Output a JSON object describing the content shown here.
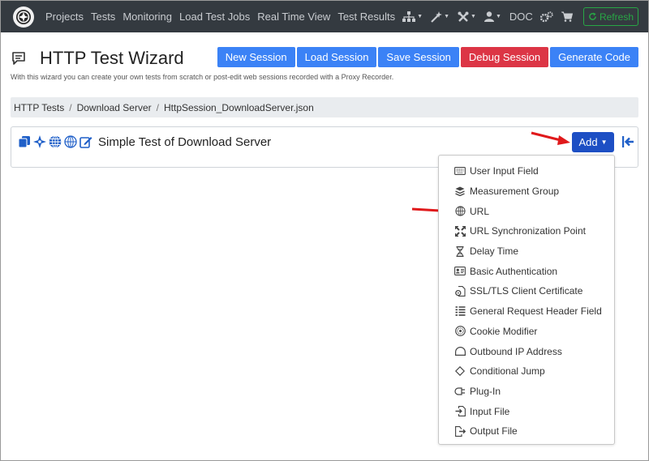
{
  "nav": {
    "links": [
      "Projects",
      "Tests",
      "Monitoring",
      "Load Test Jobs",
      "Real Time View",
      "Test Results"
    ],
    "doc": "DOC",
    "refresh": "Refresh",
    "icons": [
      "sitemap-icon",
      "wand-icon",
      "tools-icon",
      "user-icon",
      "gears-icon",
      "cart-icon"
    ]
  },
  "header": {
    "title": "HTTP Test Wizard",
    "subtitle": "With this wizard you can create your own tests from scratch or post-edit web sessions recorded with a Proxy Recorder.",
    "buttons": {
      "new_session": "New Session",
      "load_session": "Load Session",
      "save_session": "Save Session",
      "debug_session": "Debug Session",
      "generate_code": "Generate Code"
    }
  },
  "breadcrumb": [
    "HTTP Tests",
    "Download Server",
    "HttpSession_DownloadServer.json"
  ],
  "test": {
    "title": "Simple Test of Download Server",
    "add_label": "Add"
  },
  "dropdown": {
    "items": [
      {
        "label": "User Input Field",
        "icon": "keyboard-icon"
      },
      {
        "label": "Measurement Group",
        "icon": "layers-icon"
      },
      {
        "label": "URL",
        "icon": "globe-icon"
      },
      {
        "label": "URL Synchronization Point",
        "icon": "sync-point-icon"
      },
      {
        "label": "Delay Time",
        "icon": "hourglass-icon"
      },
      {
        "label": "Basic Authentication",
        "icon": "id-card-icon"
      },
      {
        "label": "SSL/TLS Client Certificate",
        "icon": "certificate-icon"
      },
      {
        "label": "General Request Header Field",
        "icon": "list-icon"
      },
      {
        "label": "Cookie Modifier",
        "icon": "cookie-icon"
      },
      {
        "label": "Outbound IP Address",
        "icon": "outbound-icon"
      },
      {
        "label": "Conditional Jump",
        "icon": "diamond-icon"
      },
      {
        "label": "Plug-In",
        "icon": "plug-icon"
      },
      {
        "label": "Input File",
        "icon": "input-file-icon"
      },
      {
        "label": "Output File",
        "icon": "output-file-icon"
      }
    ]
  },
  "colors": {
    "navbar": "#343a40",
    "primary": "#3b82f6",
    "danger": "#dc3545",
    "success": "#28a745",
    "add": "#1d4fc4",
    "arrow": "#e0191b"
  }
}
